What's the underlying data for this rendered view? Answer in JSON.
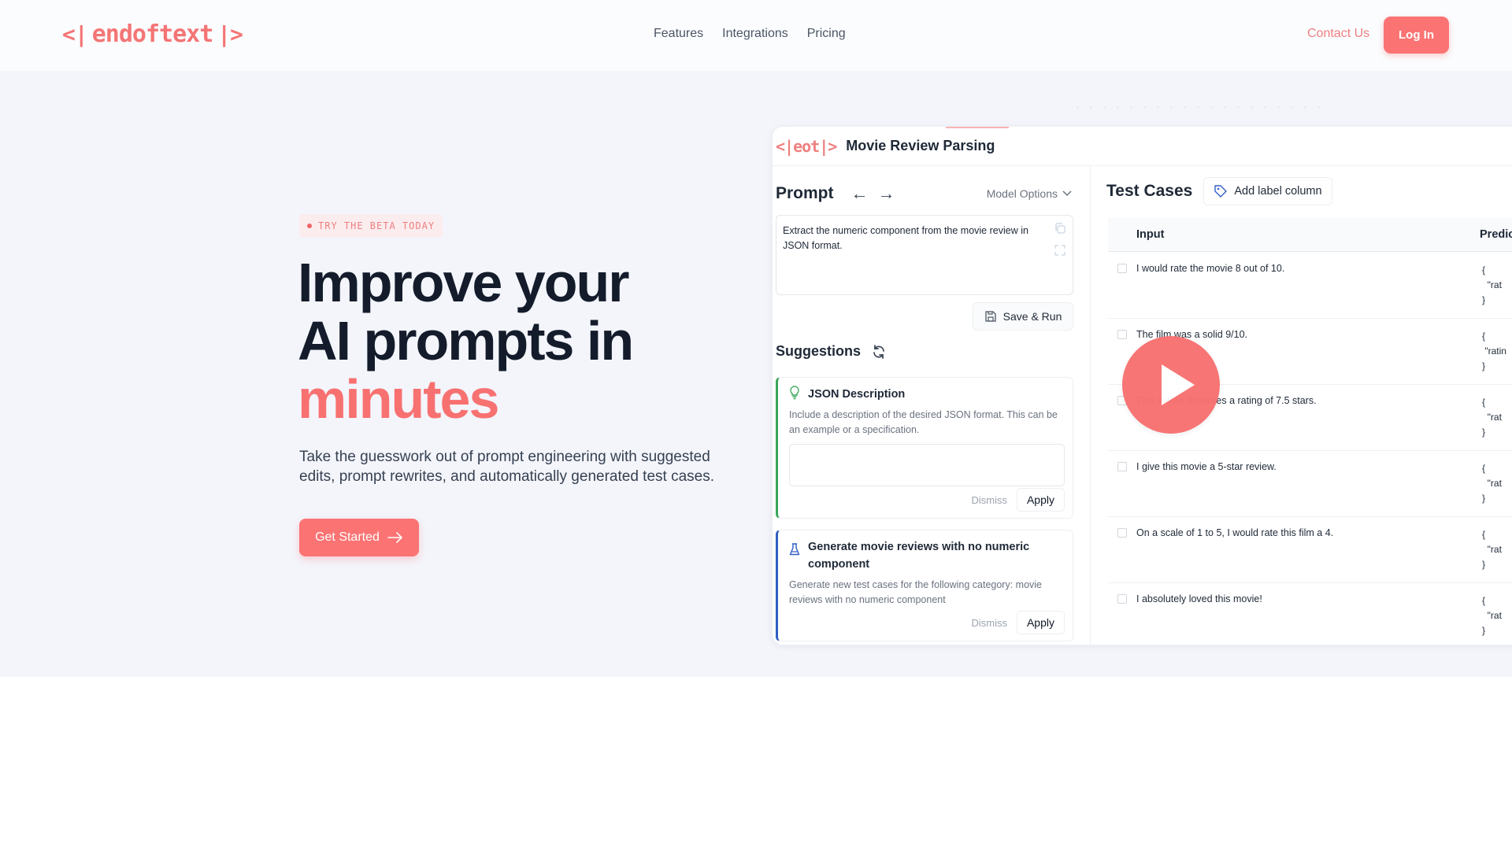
{
  "nav": {
    "logo": {
      "left": "<|",
      "word": "endoftext",
      "right": "|>"
    },
    "links": [
      "Features",
      "Integrations",
      "Pricing"
    ],
    "contact_label": "Contact Us",
    "login_label": "Log In"
  },
  "hero": {
    "badge": "TRY THE BETA TODAY",
    "headline_line1": "Improve your",
    "headline_line2": "AI prompts in",
    "headline_accent": "minutes",
    "subtext": "Take the guesswork out of prompt engineering with suggested edits, prompt rewrites, and automatically generated test cases.",
    "cta_label": "Get Started",
    "cta_icon": "arrow-right-icon"
  },
  "colors": {
    "brand": "#f87171",
    "green_accent": "#3aa55b",
    "blue_accent": "#2f5fc4",
    "heading": "#141c2b"
  },
  "app": {
    "logo": "<|eot|>",
    "title": "Movie Review Parsing",
    "prompt": {
      "heading": "Prompt",
      "back_arrow": "←",
      "forward_arrow": "→",
      "model_options": "Model Options",
      "text": "Extract the numeric component from the movie review in JSON format.",
      "save_run": "Save & Run"
    },
    "suggestions": {
      "heading": "Suggestions",
      "items": [
        {
          "icon": "lightbulb-icon",
          "title": "JSON Description",
          "description": "Include a description of the desired JSON format. This can be an example or a specification.",
          "input_value": "",
          "dismiss": "Dismiss",
          "apply": "Apply"
        },
        {
          "icon": "flask-icon",
          "title": "Generate movie reviews with no numeric component",
          "description": "Generate new test cases for the following category: movie reviews with no numeric component",
          "dismiss": "Dismiss",
          "apply": "Apply"
        }
      ]
    },
    "test_cases": {
      "heading": "Test Cases",
      "add_label_button": "Add label column",
      "columns": [
        "Input",
        "Predic"
      ],
      "rows": [
        {
          "input": "I would rate the movie 8 out of 10.",
          "prediction": "{\n  \"rat\n}"
        },
        {
          "input": "The film was a solid 9/10.",
          "prediction": "{\n \"ratin\n}"
        },
        {
          "input": "This movie deserves a rating of 7.5 stars.",
          "prediction": "{\n  \"rat\n}"
        },
        {
          "input": "I give this movie a 5-star review.",
          "prediction": "{\n  \"rat\n}"
        },
        {
          "input": "On a scale of 1 to 5, I would rate this film a 4.",
          "prediction": "{\n  \"rat\n}"
        },
        {
          "input": "I absolutely loved this movie!",
          "prediction": "{\n  \"rat\n}"
        }
      ]
    }
  },
  "video": {
    "play_icon": "play-icon"
  }
}
